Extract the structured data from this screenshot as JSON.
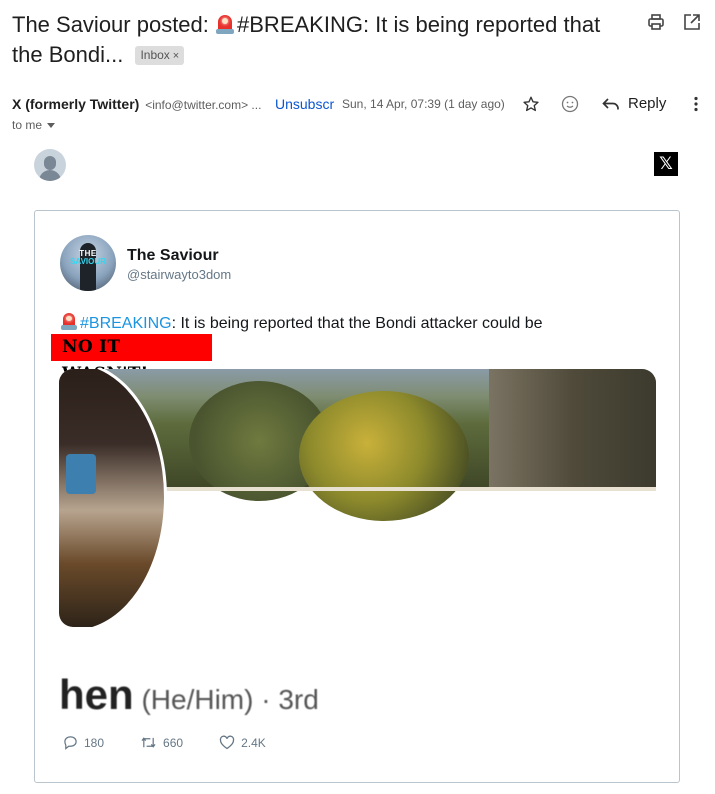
{
  "email": {
    "subject": {
      "prefix": "The Saviour posted: ",
      "icon": "police-siren-icon",
      "suffix": "#BREAKING: It is being reported that the Bondi...",
      "label_chip": "Inbox",
      "label_chip_remove": "×"
    },
    "toolbar_icons": [
      "print-icon",
      "open-in-new-window-icon"
    ],
    "sender": {
      "name": "X (formerly Twitter)",
      "email": "<info@twitter.com> ...",
      "unsubscribe": "Unsubscribe",
      "date": "Sun, 14 Apr, 07:39 (1 day ago)",
      "reply_label": "Reply",
      "recipient": "to me"
    }
  },
  "tweet": {
    "author_name": "The Saviour",
    "author_handle": "@stairwayto3dom",
    "avatar_text_top": "THE",
    "avatar_text_bottom": "SAVIOUR",
    "hashtag": "#BREAKING",
    "text": ": It is being reported that the Bondi attacker could be",
    "overlay_stamp": "NO IT WASN'T!",
    "image_caption": {
      "name_fragment": "hen",
      "details": " (He/Him) · 3rd"
    },
    "stats": {
      "replies": "180",
      "retweets": "660",
      "likes": "2.4K"
    }
  },
  "brand_logo": "𝕏",
  "colors": {
    "link_blue": "#0b57d0",
    "hashtag_blue": "#1b95e0",
    "stamp_red": "#ff0000"
  }
}
